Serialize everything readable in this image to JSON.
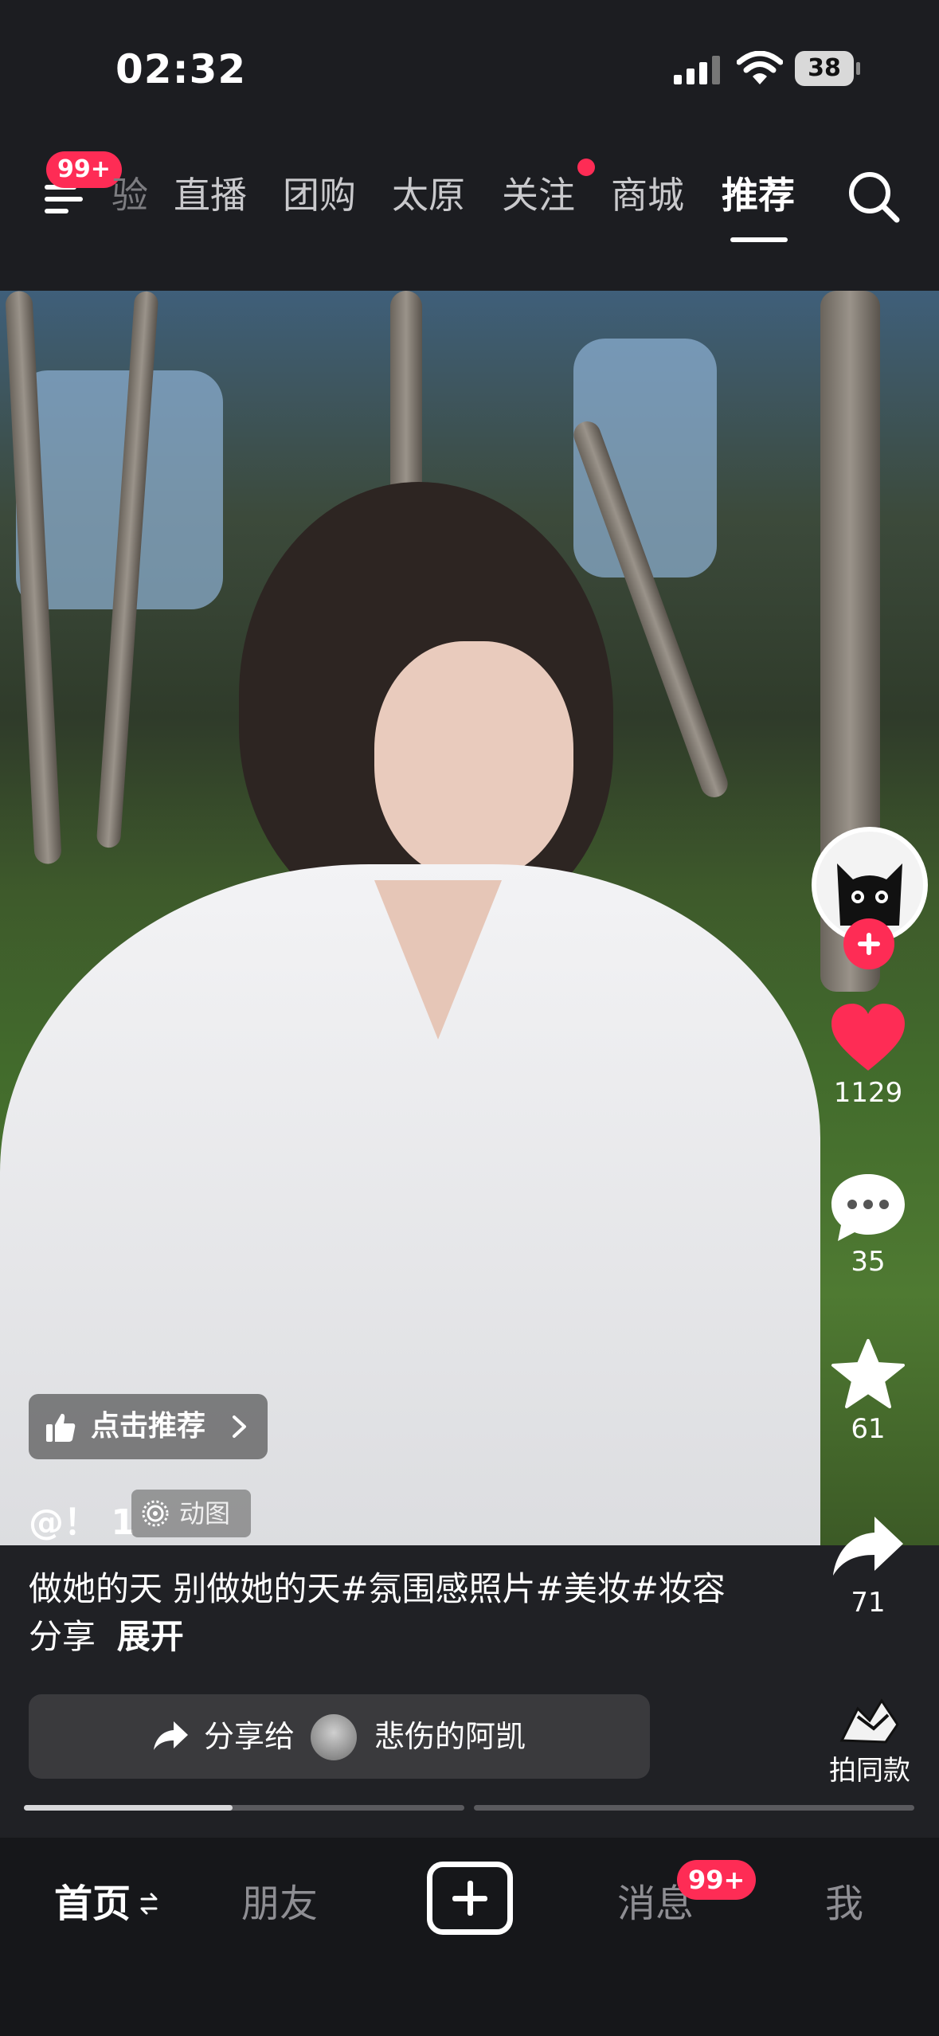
{
  "status_bar": {
    "time": "02:32",
    "battery": "38"
  },
  "top_nav": {
    "menu_badge": "99+",
    "tabs": [
      {
        "label": "验",
        "active": false
      },
      {
        "label": "直播",
        "active": false
      },
      {
        "label": "团购",
        "active": false
      },
      {
        "label": "太原",
        "active": false
      },
      {
        "label": "关注",
        "active": false,
        "dot": true
      },
      {
        "label": "商城",
        "active": false
      },
      {
        "label": "推荐",
        "active": true
      }
    ]
  },
  "video": {
    "recommend_chip": "点击推荐",
    "author_handle": "@！ 1",
    "photo_badge": "动图"
  },
  "actions": {
    "likes": "1129",
    "comments": "35",
    "shares": "71",
    "same_style": "拍同款"
  },
  "caption": {
    "text": "做她的天 别做她的天#氛围感照片#美妆#妆容分享",
    "expand": "展开"
  },
  "share_bar": {
    "label": "分享给",
    "contact_name": "悲伤的阿凯"
  },
  "progress": {
    "segments": 2,
    "current_fill": 0.47
  },
  "bottom_nav": {
    "home": "首页",
    "friends": "朋友",
    "messages": "消息",
    "messages_badge": "99+",
    "me": "我"
  },
  "colors": {
    "accent": "#fe2c55",
    "background": "#202125"
  }
}
